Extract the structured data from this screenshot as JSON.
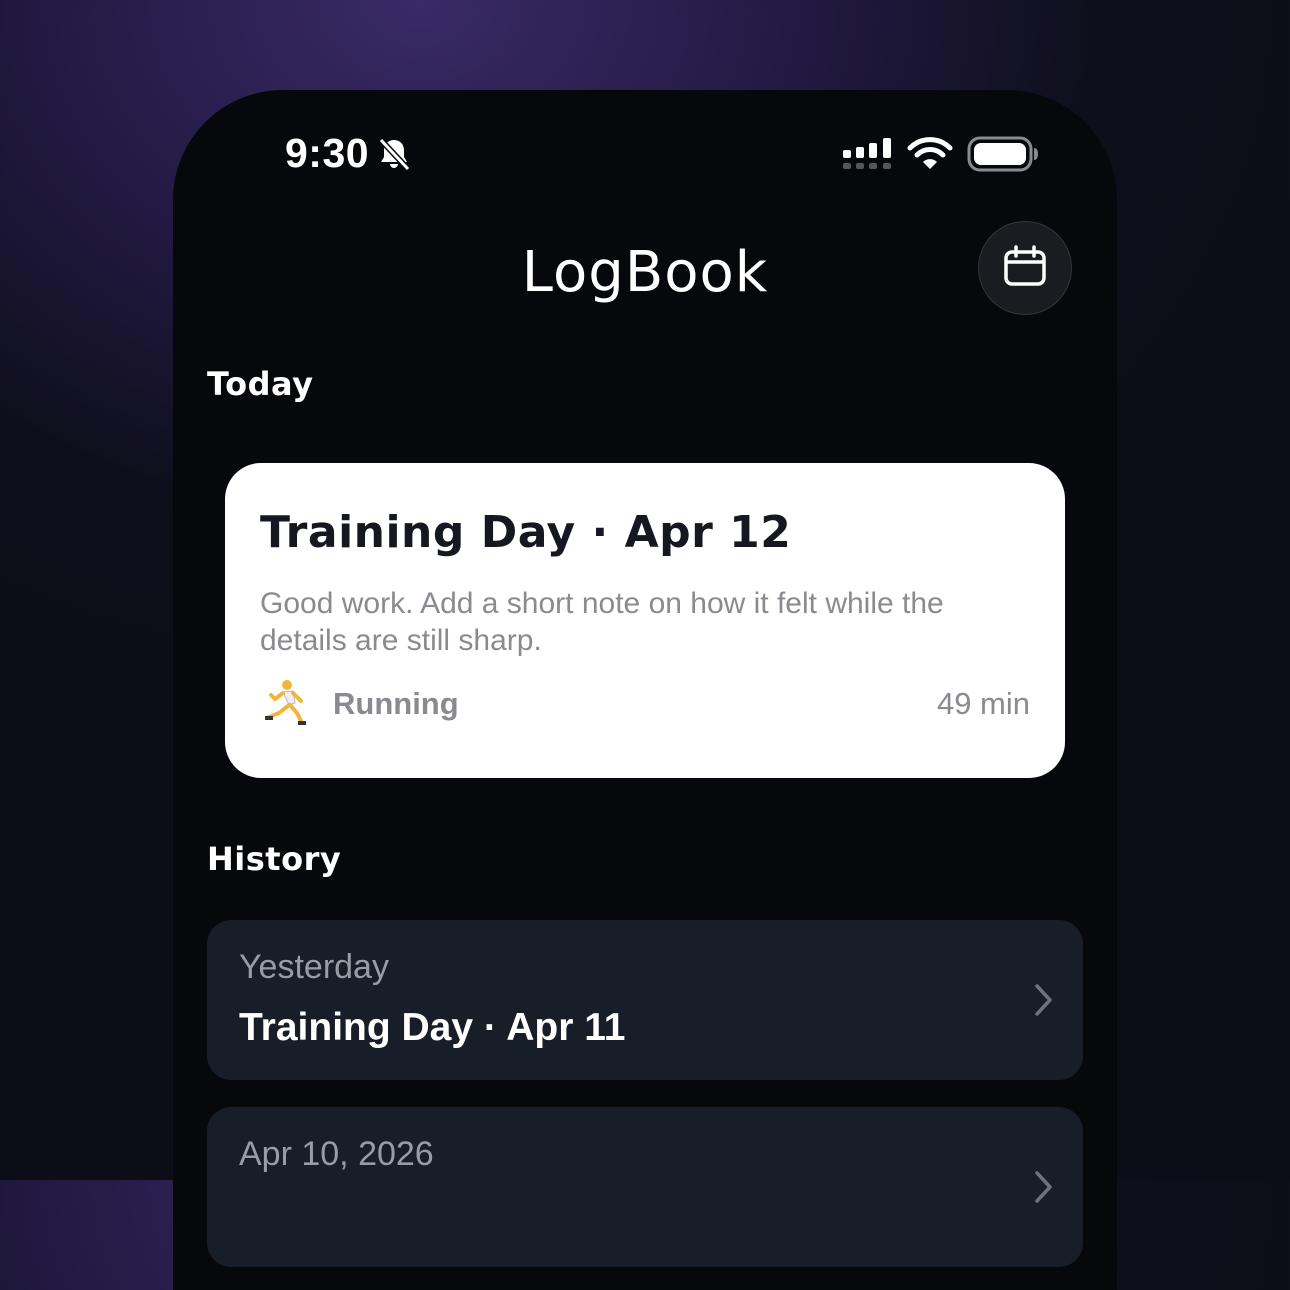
{
  "status_bar": {
    "time": "9:30",
    "icons": [
      "bell-slash-icon",
      "signal-icon",
      "wifi-icon",
      "battery-icon"
    ]
  },
  "header": {
    "title": "LogBook",
    "calendar_button_icon": "calendar-icon"
  },
  "today": {
    "heading": "Today",
    "card": {
      "title": "Training Day · Apr 12",
      "description": "Good work. Add a short note on how it felt while the details are still sharp.",
      "activity_icon": "🏃",
      "activity": "Running",
      "duration": "49 min"
    }
  },
  "history": {
    "heading": "History",
    "items": [
      {
        "subtitle": "Yesterday",
        "title": "Training Day · Apr 11"
      },
      {
        "subtitle": "Apr 10, 2026",
        "title": ""
      }
    ]
  },
  "colors": {
    "card_bg": "#ffffff",
    "history_row_bg": "#171e27",
    "phone_bg": "#07080b",
    "muted_text": "#8a8b90"
  }
}
